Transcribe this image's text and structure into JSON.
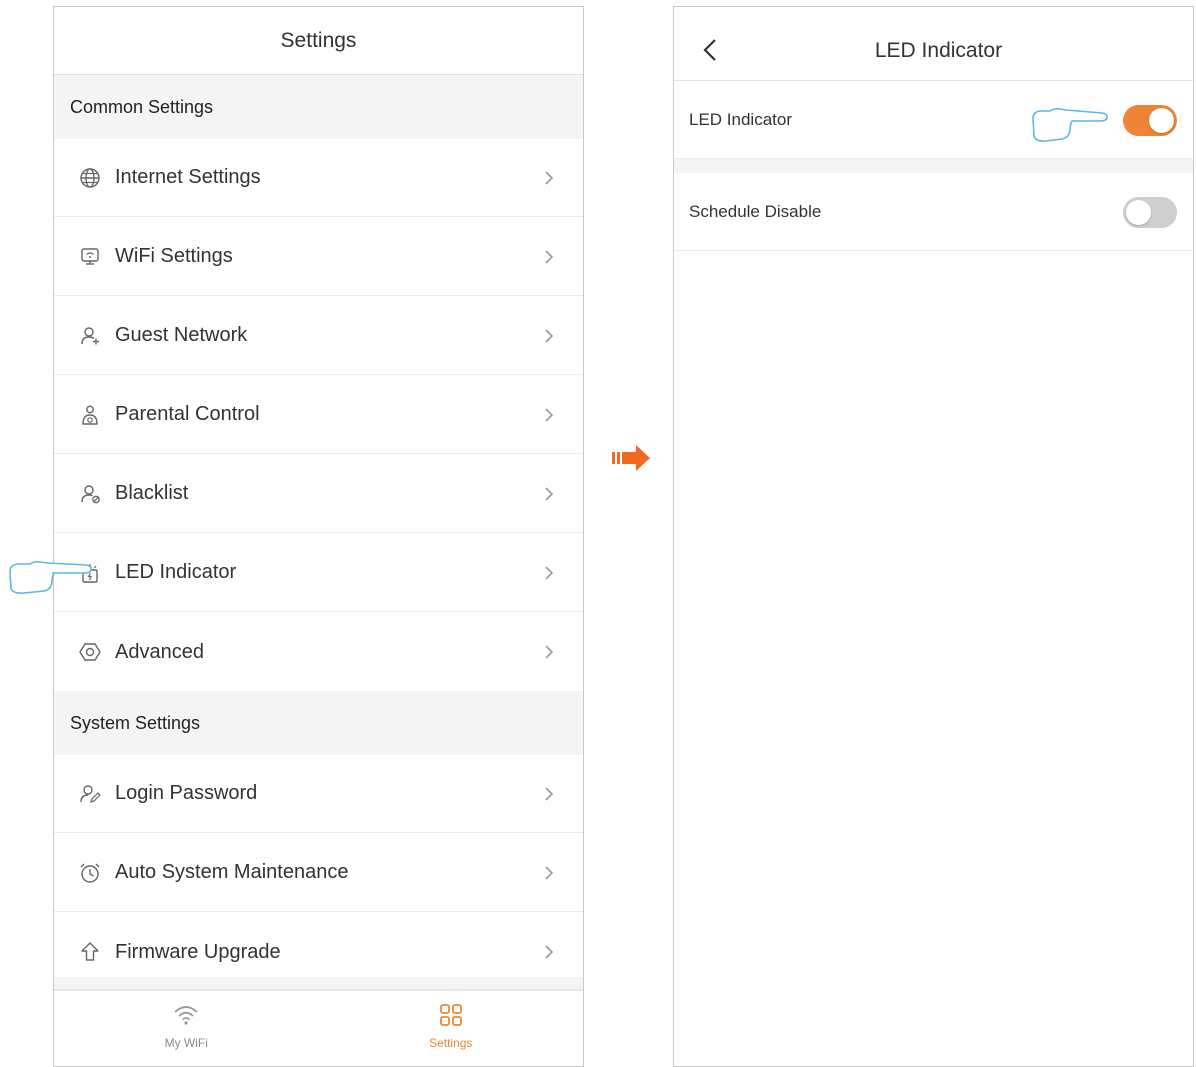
{
  "left_screen": {
    "title": "Settings",
    "common_settings_title": "Common Settings",
    "common_items": [
      {
        "label": "Internet Settings",
        "icon": "globe-icon"
      },
      {
        "label": "WiFi Settings",
        "icon": "wifi-router-icon"
      },
      {
        "label": "Guest Network",
        "icon": "guest-icon"
      },
      {
        "label": "Parental Control",
        "icon": "parental-control-icon"
      },
      {
        "label": "Blacklist",
        "icon": "blacklist-icon"
      },
      {
        "label": "LED Indicator",
        "icon": "led-indicator-icon"
      },
      {
        "label": "Advanced",
        "icon": "hexagon-icon"
      }
    ],
    "system_settings_title": "System Settings",
    "system_items": [
      {
        "label": "Login Password",
        "icon": "user-edit-icon"
      },
      {
        "label": "Auto System Maintenance",
        "icon": "alarm-clock-icon"
      },
      {
        "label": "Firmware Upgrade",
        "icon": "upgrade-arrow-icon"
      }
    ],
    "tabs": [
      {
        "label": "My WiFi",
        "icon": "wifi-icon",
        "active": false
      },
      {
        "label": "Settings",
        "icon": "grid-icon",
        "active": true
      }
    ]
  },
  "right_screen": {
    "title": "LED Indicator",
    "rows": [
      {
        "label": "LED Indicator",
        "toggle_on": true
      },
      {
        "label": "Schedule Disable",
        "toggle_on": false
      }
    ]
  },
  "colors": {
    "accent": "#ef8436",
    "toggle_off": "#cfcfcf",
    "hand_outline": "#5cb6e6",
    "section_bg": "#f4f4f4"
  }
}
